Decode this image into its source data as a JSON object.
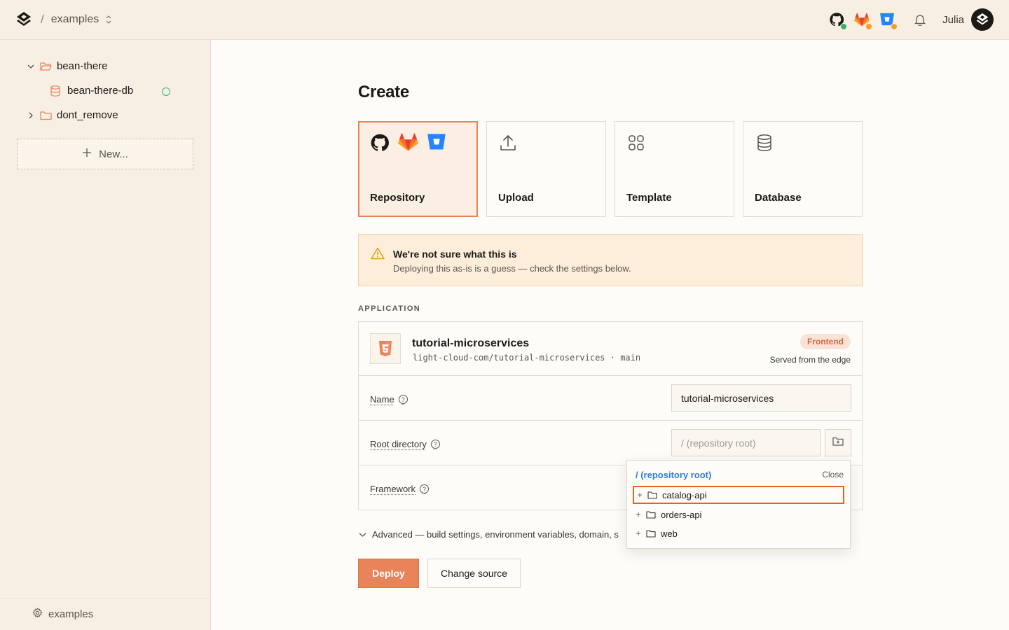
{
  "topbar": {
    "project": "examples",
    "user": "Julia"
  },
  "sidebar": {
    "items": [
      {
        "label": "bean-there"
      },
      {
        "label": "bean-there-db"
      },
      {
        "label": "dont_remove"
      }
    ],
    "new_label": "New...",
    "footer_label": "examples"
  },
  "main": {
    "title": "Create",
    "sources": [
      {
        "label": "Repository"
      },
      {
        "label": "Upload"
      },
      {
        "label": "Template"
      },
      {
        "label": "Database"
      }
    ],
    "alert": {
      "title": "We're not sure what this is",
      "body": "Deploying this as-is is a guess — check the settings below."
    },
    "section_label": "APPLICATION",
    "app": {
      "name": "tutorial-microservices",
      "repo": "light-cloud-com/tutorial-microservices · main",
      "badge": "Frontend",
      "subtitle": "Served from the edge"
    },
    "form": {
      "name_label": "Name",
      "name_value": "tutorial-microservices",
      "root_label": "Root directory",
      "root_placeholder": "/ (repository root)",
      "framework_label": "Framework"
    },
    "advanced": "Advanced — build settings, environment variables, domain, s",
    "deploy": "Deploy",
    "change_source": "Change source"
  },
  "popover": {
    "root": "/ (repository root)",
    "close": "Close",
    "folders": [
      {
        "name": "catalog-api"
      },
      {
        "name": "orders-api"
      },
      {
        "name": "web"
      }
    ]
  },
  "colors": {
    "accent": "#e8835a",
    "link": "#2f7fd1",
    "success": "#37b46a"
  }
}
